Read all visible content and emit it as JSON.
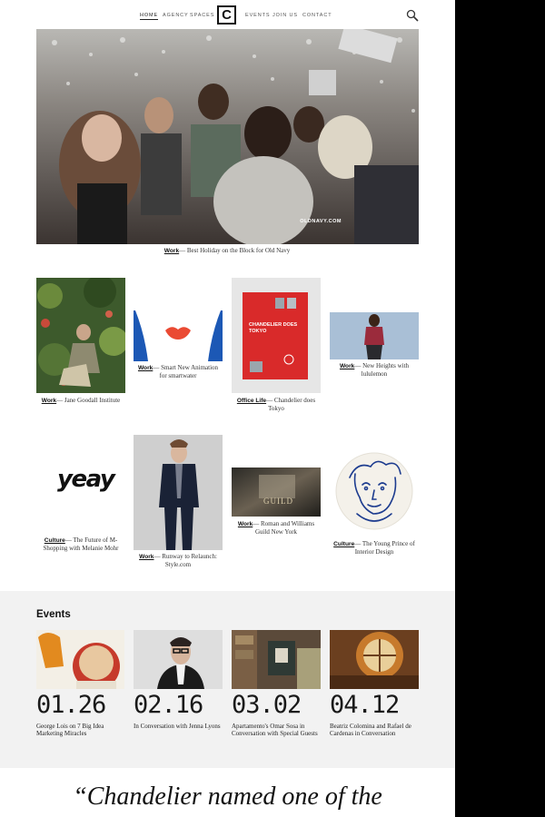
{
  "nav": {
    "items": [
      "HOME",
      "AGENCY",
      "SPACES",
      "EVENTS",
      "JOIN US",
      "CONTACT"
    ],
    "logo": "C"
  },
  "hero": {
    "watermark": "OLDNAVY.COM",
    "tag": "Work",
    "caption": "— Best Holiday on the Block for Old Navy"
  },
  "grid": [
    {
      "tag": "Work",
      "text": "— Jane Goodall Institute"
    },
    {
      "tag": "Work",
      "text": "— Smart New Animation for smartwater"
    },
    {
      "tag": "Office Life",
      "text": "— Chandelier does Tokyo",
      "book_title": "CHANDELIER DOES TOKYO"
    },
    {
      "tag": "Work",
      "text": "— New Heights with lululemon"
    },
    {
      "tag": "Culture",
      "text": "— The Future of M-Shopping with Melanie Mohr",
      "art_word": "yeay"
    },
    {
      "tag": "Work",
      "text": "— Runway to Relaunch: Style.com"
    },
    {
      "tag": "Work",
      "text": "— Roman and Williams Guild New York",
      "sign": "GUILD"
    },
    {
      "tag": "Culture",
      "text": "— The Young Prince of Interior Design"
    }
  ],
  "events": {
    "title": "Events",
    "items": [
      {
        "date": "01.26",
        "caption": "George Lois on 7 Big Idea Marketing Miracles"
      },
      {
        "date": "02.16",
        "caption": "In Conversation with Jenna Lyons"
      },
      {
        "date": "03.02",
        "caption": "Apartamento's Omar Sosa in Conversation with Special Guests"
      },
      {
        "date": "04.12",
        "caption": "Beatriz Colomina and Rafael de Cardenas in Conversation"
      }
    ]
  },
  "quote": "“Chandelier named one of the",
  "colors": {
    "background": "#ffffff",
    "events_bg": "#f2f2f2",
    "side": "#000000",
    "text": "#222222"
  },
  "icons": [
    "search-icon"
  ]
}
